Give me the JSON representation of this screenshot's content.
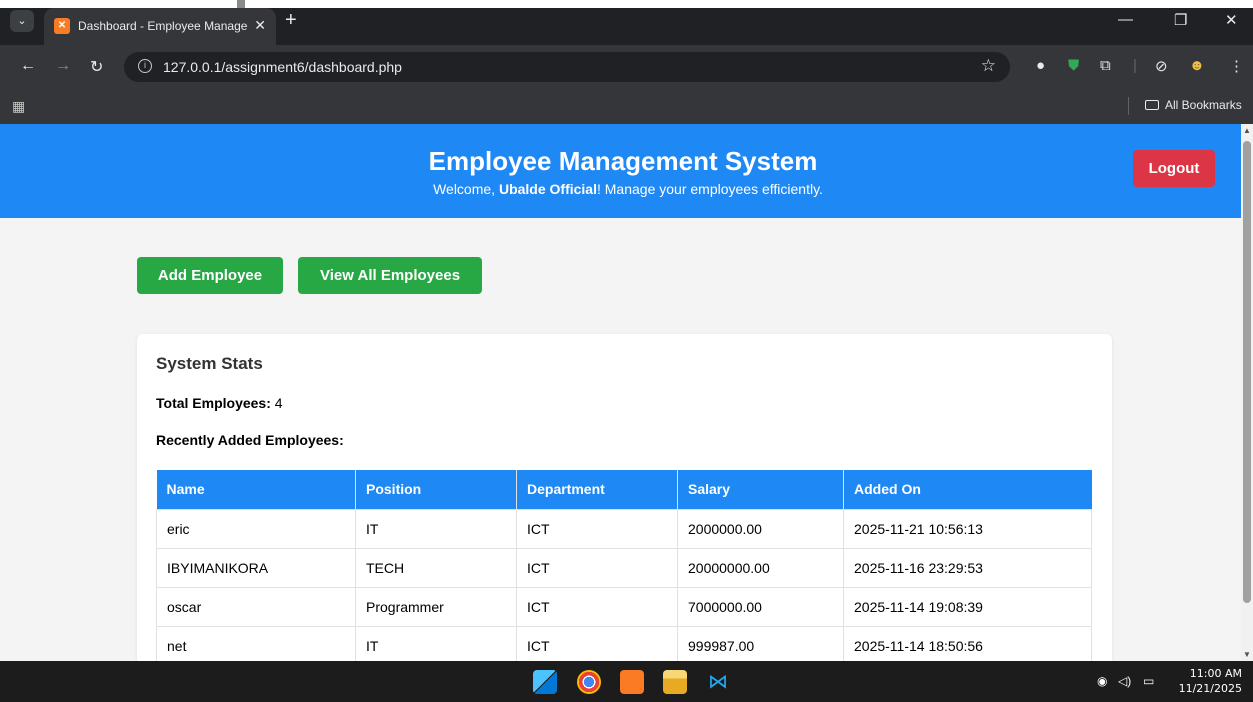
{
  "browser": {
    "tab_title": "Dashboard - Employee Manage",
    "url": "127.0.0.1/assignment6/dashboard.php",
    "bookmarks_label": "All Bookmarks",
    "icons": [
      "tab-search-icon",
      "favicon-icon",
      "close-icon",
      "new-tab-icon",
      "minimize-icon",
      "restore-icon",
      "close-window-icon",
      "back-icon",
      "forward-icon",
      "reload-icon",
      "site-info-icon",
      "bookmark-star-icon",
      "extension-icon",
      "apps-icon",
      "folder-icon"
    ]
  },
  "header": {
    "title": "Employee Management System",
    "welcome_prefix": "Welcome, ",
    "user_name": "Ubalde Official",
    "welcome_suffix": "! Manage your employees efficiently.",
    "logout_label": "Logout",
    "background_color": "#1e88f5",
    "logout_color": "#dc3545"
  },
  "actions": {
    "add_label": "Add Employee",
    "view_all_label": "View All Employees",
    "button_color": "#28a745"
  },
  "stats": {
    "heading": "System Stats",
    "total_label": "Total Employees:",
    "total_value": "4",
    "recent_label": "Recently Added Employees:"
  },
  "table": {
    "columns": [
      "Name",
      "Position",
      "Department",
      "Salary",
      "Added On"
    ],
    "rows": [
      [
        "eric",
        "IT",
        "ICT",
        "2000000.00",
        "2025-11-21 10:56:13"
      ],
      [
        "IBYIMANIKORA",
        "TECH",
        "ICT",
        "20000000.00",
        "2025-11-16 23:29:53"
      ],
      [
        "oscar",
        "Programmer",
        "ICT",
        "7000000.00",
        "2025-11-14 19:08:39"
      ],
      [
        "net",
        "IT",
        "ICT",
        "999987.00",
        "2025-11-14 18:50:56"
      ]
    ]
  },
  "taskbar": {
    "time": "11:00 AM",
    "date": "11/21/2025"
  }
}
